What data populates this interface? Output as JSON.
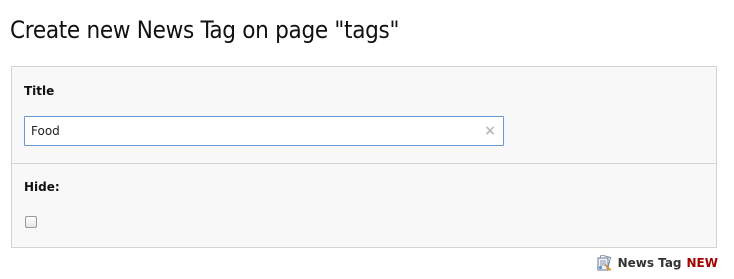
{
  "header": {
    "title": "Create new News Tag on page \"tags\""
  },
  "form": {
    "title_field": {
      "label": "Title",
      "value": "Food",
      "clear_icon": "×"
    },
    "hide_field": {
      "label": "Hide:",
      "checked": false
    }
  },
  "footer": {
    "record_type": "News Tag",
    "record_status": "NEW",
    "icon": "news-tag-icon"
  }
}
